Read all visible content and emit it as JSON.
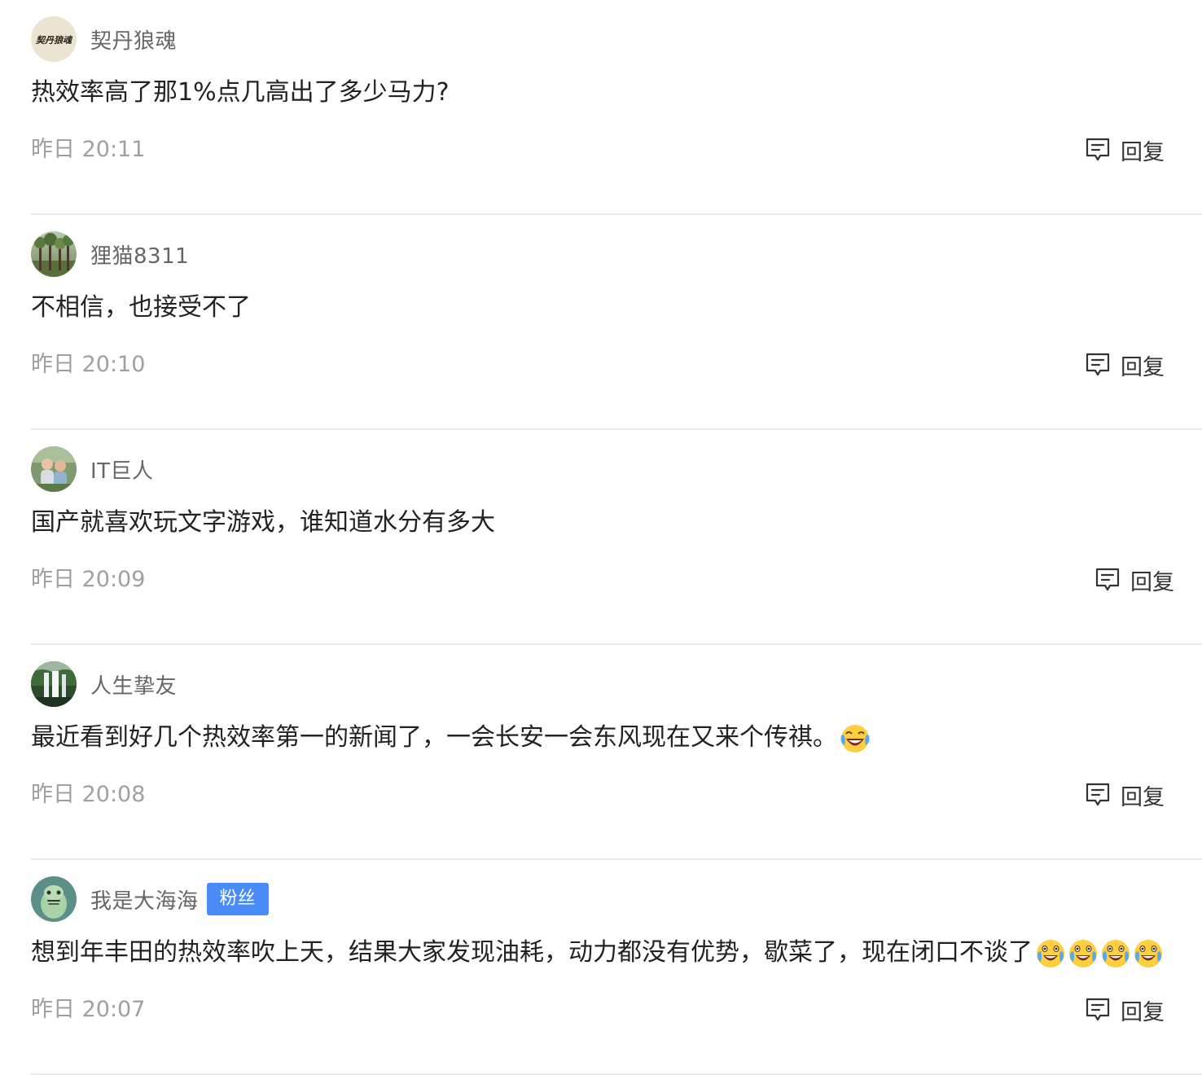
{
  "reply_label": "回复",
  "comments": [
    {
      "username": "契丹狼魂",
      "avatar_text": "契丹狼魂",
      "content": "热效率高了那1%点几高出了多少马力?",
      "time": "昨日 20:11"
    },
    {
      "username": "狸猫8311",
      "content": "不相信，也接受不了",
      "time": "昨日 20:10"
    },
    {
      "username": "IT巨人",
      "content": "国产就喜欢玩文字游戏，谁知道水分有多大",
      "time": "昨日 20:09"
    },
    {
      "username": "人生挚友",
      "content": "最近看到好几个热效率第一的新闻了，一会长安一会东风现在又来个传祺。",
      "emojis": [
        "laugh-cry-emoji"
      ],
      "time": "昨日 20:08"
    },
    {
      "username": "我是大海海",
      "badge": "粉丝",
      "content": "想到年丰田的热效率吹上天，结果大家发现油耗，动力都没有优势，歇菜了，现在闭口不谈了",
      "emojis": [
        "tears-of-joy-emoji",
        "tears-of-joy-emoji",
        "tears-of-joy-emoji",
        "tears-of-joy-emoji"
      ],
      "time": "昨日 20:07"
    }
  ],
  "colors": {
    "badge_bg": "#4a8cf7",
    "username": "#666666",
    "content": "#222222",
    "timestamp": "#a0a0a0",
    "divider": "#e9e9e9"
  }
}
